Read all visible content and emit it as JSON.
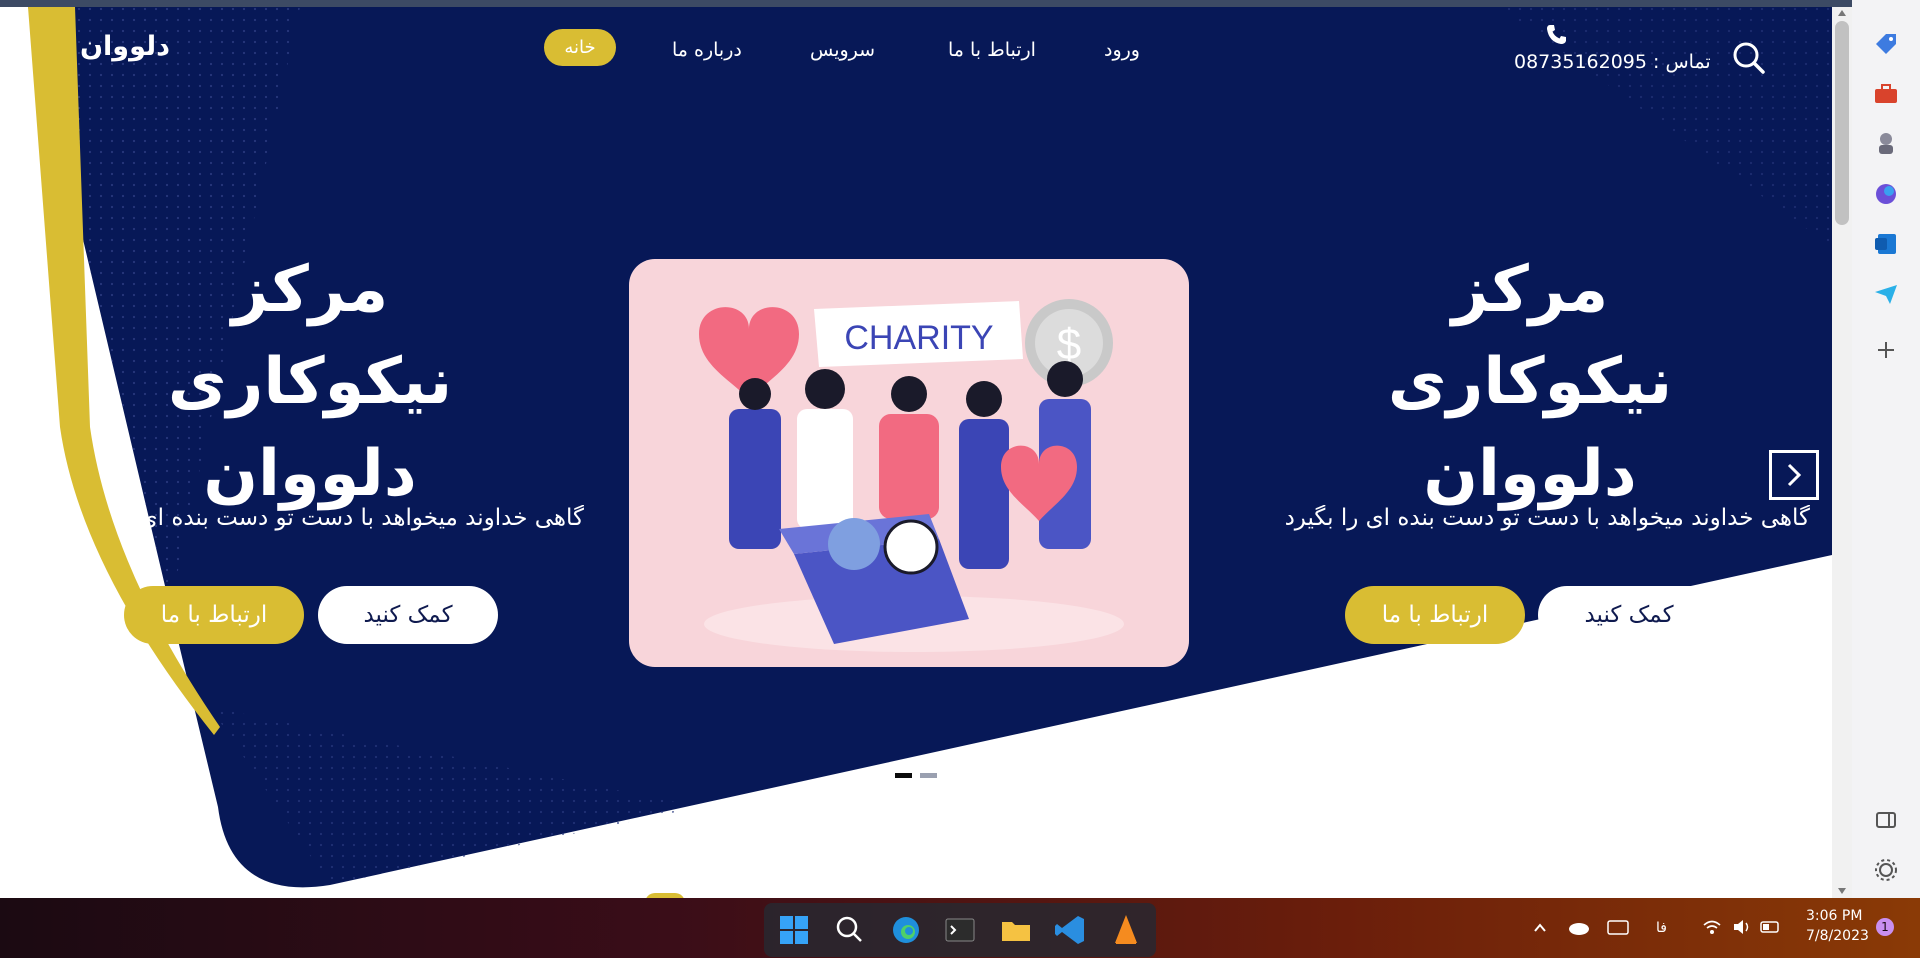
{
  "site": {
    "brand": "دلووان",
    "nav": {
      "home": "خانه",
      "about": "درباره ما",
      "service": "سرویس",
      "contact": "ارتباط با ما",
      "login": "ورود"
    },
    "contact_label": "تماس : 08735162095"
  },
  "hero": {
    "slide_left": {
      "title_line1": "مرکز نیکوکاری",
      "title_line2": "دلووان",
      "subtitle": "گاهی خداوند میخواهد با دست تو دست بنده ای را بگیرد",
      "btn_help": "کمک کنید",
      "btn_contact": "ارتباط با ما"
    },
    "slide_right": {
      "title_line1": "مرکز نیکوکاری",
      "title_line2": "دلووان",
      "subtitle": "گاهی خداوند میخواهد با دست تو دست بنده ای را بگیرد",
      "btn_help": "کمک کنید",
      "btn_contact": "ارتباط با ما"
    },
    "card_banner": "CHARITY",
    "card_coin": "$",
    "active_slide": 1,
    "slide_count": 2
  },
  "taskbar": {
    "time": "3:06 PM",
    "date": "7/8/2023",
    "lang": "فا",
    "notifications": "1"
  },
  "colors": {
    "navy": "#071857",
    "accent_yellow": "#d9bd33",
    "card_pink": "#f8d5da"
  }
}
